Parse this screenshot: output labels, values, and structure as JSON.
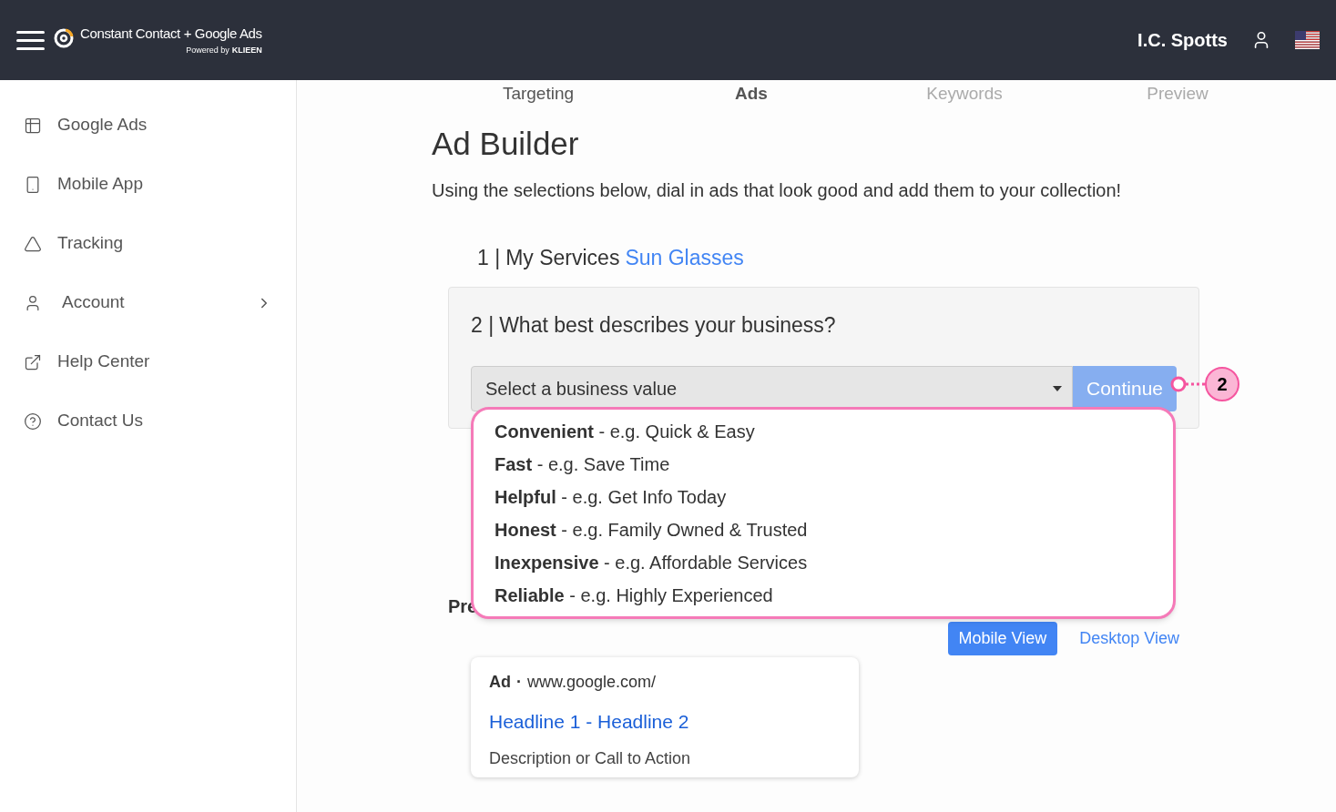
{
  "header": {
    "brand": "Constant Contact + Google Ads",
    "powered_by": "Powered by",
    "powered_brand": "KLIEEN",
    "user_name": "I.C. Spotts"
  },
  "sidebar": {
    "items": [
      {
        "label": "Google Ads",
        "has_submenu": false
      },
      {
        "label": "Mobile App",
        "has_submenu": false
      },
      {
        "label": "Tracking",
        "has_submenu": false
      },
      {
        "label": "Account",
        "has_submenu": true
      },
      {
        "label": "Help Center",
        "has_submenu": false
      },
      {
        "label": "Contact Us",
        "has_submenu": false
      }
    ]
  },
  "steps_nav": [
    {
      "label": "Targeting",
      "selected": false,
      "disabled": false
    },
    {
      "label": "Ads",
      "selected": true,
      "disabled": false
    },
    {
      "label": "Keywords",
      "selected": false,
      "disabled": true
    },
    {
      "label": "Preview",
      "selected": false,
      "disabled": true
    }
  ],
  "main": {
    "title": "Ad Builder",
    "subtitle": "Using the selections below, dial in ads that look good and add them to your collection!",
    "step1": {
      "number": "1 |",
      "label": "My Services",
      "value": "Sun Glasses"
    },
    "step2": {
      "number": "2 |",
      "label": "What best describes your business?",
      "select_value": "Select a business value",
      "button": "Continue",
      "button_disabled": true
    },
    "dropdown_options": [
      {
        "bold": "Convenient",
        "rest": "- e.g. Quick & Easy"
      },
      {
        "bold": "Fast",
        "rest": "- e.g. Save Time"
      },
      {
        "bold": "Helpful",
        "rest": "- e.g. Get Info Today"
      },
      {
        "bold": "Honest",
        "rest": "- e.g. Family Owned & Trusted"
      },
      {
        "bold": "Inexpensive",
        "rest": "- e.g. Affordable Services"
      },
      {
        "bold": "Reliable",
        "rest": "- e.g. Highly Experienced"
      }
    ],
    "preview_label": "Pre",
    "view_toggle": [
      {
        "label": "Mobile View",
        "selected": true
      },
      {
        "label": "Desktop View",
        "selected": false
      }
    ],
    "ad_preview": {
      "ad_label": "Ad",
      "separator": "·",
      "url": "www.google.com/",
      "headline": "Headline 1 - Headline 2",
      "description": "Description or Call to Action"
    }
  },
  "callout": {
    "number": "2"
  }
}
